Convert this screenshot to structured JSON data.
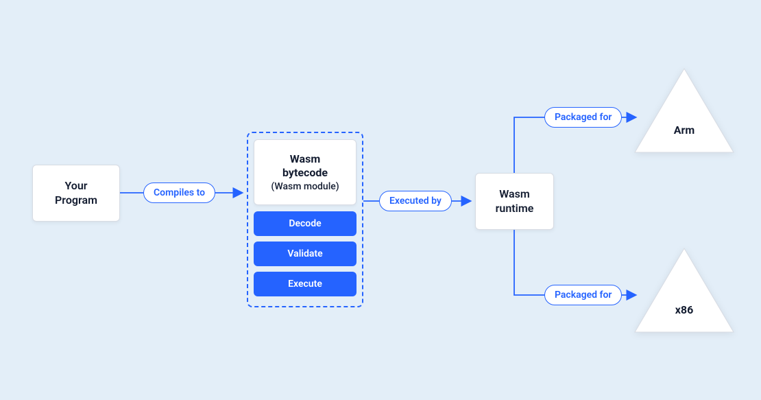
{
  "nodes": {
    "program": {
      "line1": "Your",
      "line2": "Program"
    },
    "wasm_bytecode": {
      "title1": "Wasm",
      "title2": "bytecode",
      "subtitle": "(Wasm module)"
    },
    "steps": {
      "decode": "Decode",
      "validate": "Validate",
      "execute": "Execute"
    },
    "runtime": {
      "line1": "Wasm",
      "line2": "runtime"
    },
    "target_arm": "Arm",
    "target_x86": "x86"
  },
  "edges": {
    "compiles_to": "Compiles to",
    "executed_by": "Executed by",
    "packaged_for_arm": "Packaged for",
    "packaged_for_x86": "Packaged for"
  },
  "colors": {
    "accent": "#2563ff",
    "bg": "#e3eef8"
  }
}
